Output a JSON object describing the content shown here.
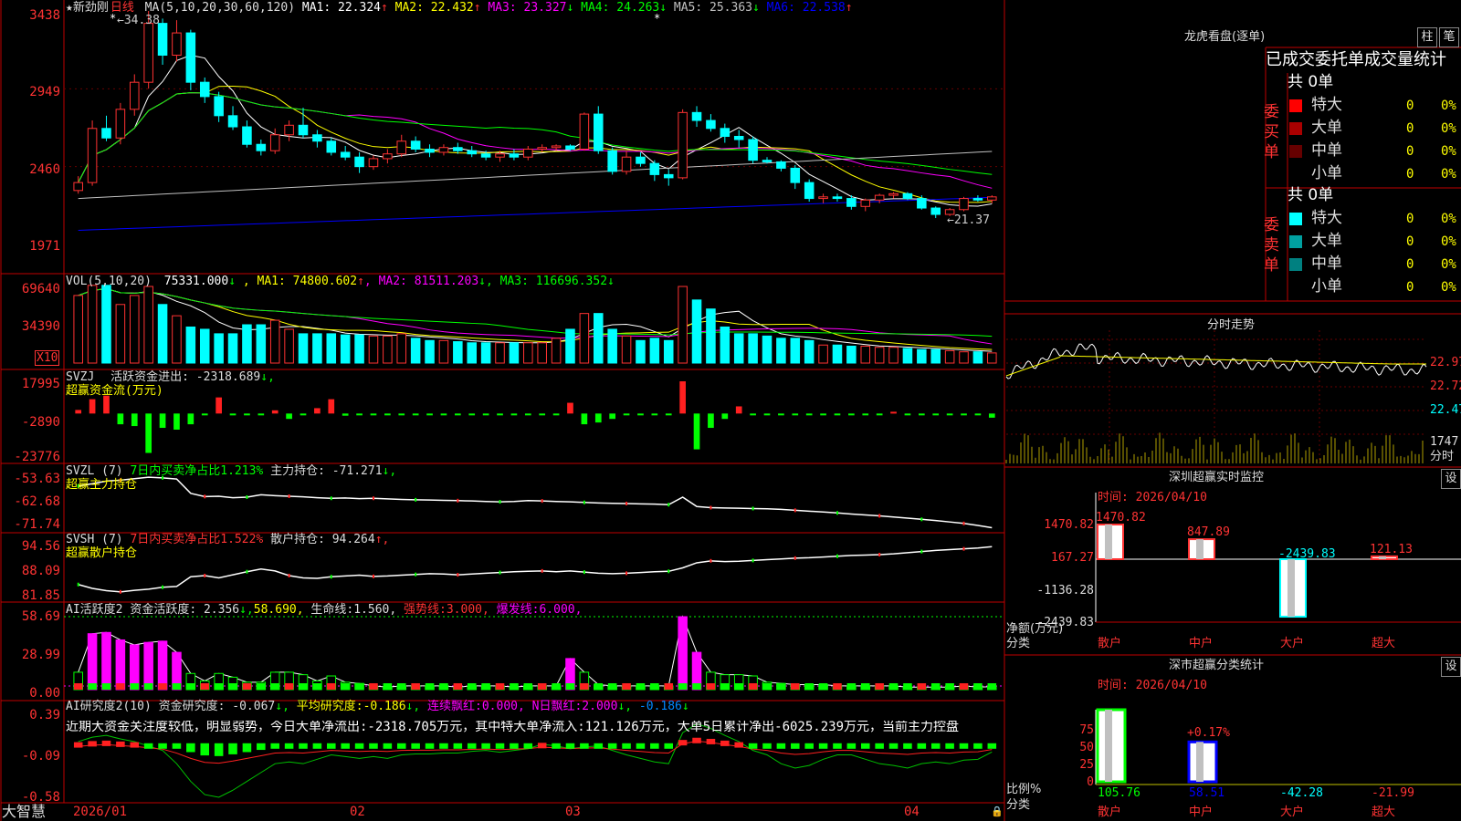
{
  "colors": {
    "up": "#ff3232",
    "down": "#00ffff",
    "grid": "#a00000",
    "ma1": "#ffffff",
    "ma2": "#ffff00",
    "ma3": "#ff00ff",
    "ma4": "#00ff00",
    "ma5": "#c0c0c0",
    "ma6": "#0000ff"
  },
  "kline": {
    "title": "★新劲刚",
    "period": "日线",
    "ma_params": "MA(5,10,20,30,60,120)",
    "ma": [
      {
        "label": "MA1:",
        "value": "22.324",
        "arrow": "↑"
      },
      {
        "label": "MA2:",
        "value": "22.432",
        "arrow": "↑"
      },
      {
        "label": "MA3:",
        "value": "23.327",
        "arrow": "↓"
      },
      {
        "label": "MA4:",
        "value": "24.263",
        "arrow": "↓"
      },
      {
        "label": "MA5:",
        "value": "25.363",
        "arrow": "↓"
      },
      {
        "label": "MA6:",
        "value": "22.538",
        "arrow": "↑"
      }
    ],
    "high_label": "34.38",
    "low_label": "21.37",
    "star": "*",
    "yaxis": [
      "3438",
      "2949",
      "2460",
      "1971"
    ]
  },
  "vol": {
    "title": "VOL(5,10,20)",
    "value": "75331.000",
    "arrow": "↓",
    "ma": [
      {
        "label": "MA1:",
        "value": "74800.602",
        "arrow": "↑"
      },
      {
        "label": "MA2:",
        "value": "81511.203",
        "arrow": "↓"
      },
      {
        "label": "MA3:",
        "value": "116696.352",
        "arrow": "↓"
      }
    ],
    "yaxis": [
      "69640",
      "34390"
    ],
    "unit": "X10"
  },
  "svzj": {
    "title": "SVZJ",
    "text": "活跃资金进出:",
    "value": "-2318.689",
    "arrow": "↓,",
    "subtitle": "超赢资金流(万元)",
    "yaxis": [
      "17995",
      "-2890",
      "-23776"
    ]
  },
  "svzl": {
    "title": "SVZL (7)",
    "t1": "7日内买卖净占比1.213%",
    "t2": "主力持仓:",
    "value": "-71.271",
    "arrow": "↓,",
    "subtitle": "超赢主力持仓",
    "yaxis": [
      "-53.63",
      "-62.68",
      "-71.74"
    ]
  },
  "svsh": {
    "title": "SVSH (7)",
    "t1": "7日内买卖净占比1.522%",
    "t2": "散户持仓:",
    "value": "94.264",
    "arrow": "↑,",
    "subtitle": "超赢散户持仓",
    "yaxis": [
      "94.56",
      "88.09",
      "81.85"
    ]
  },
  "ai1": {
    "title": "AI活跃度2",
    "t1": "资金活跃度:",
    "v1": "2.356",
    "a1": "↓,",
    "v2": "58.690,",
    "t3": "生命线:",
    "v3": "1.560,",
    "t4": "强势线:",
    "v4": "3.000,",
    "t5": "爆发线:",
    "v5": "6.000,",
    "yaxis": [
      "58.69",
      "28.99",
      "0.00"
    ]
  },
  "ai2": {
    "title": "AI研究度2(10)",
    "t1": "资金研究度:",
    "v1": "-0.067",
    "a1": "↓,",
    "t2": "平均研究度:",
    "v2": "-0.186",
    "a2": "↓,",
    "t3": "连续飘红:",
    "v3": "0.000,",
    "t4": "N日飘红:",
    "v4": "2.000",
    "a4": "↓,",
    "v5": "-0.186",
    "a5": "↓",
    "note": "近期大资金关注度较低，明显弱势，今日大单净流出:-2318.705万元，其中特大单净流入:121.126万元，大单5日累计净出-6025.239万元，当前主力控盘",
    "yaxis": [
      "0.39",
      "-0.09",
      "-0.58"
    ]
  },
  "xaxis": {
    "brand": "大智慧",
    "labels": [
      "2026/01",
      "02",
      "03",
      "04"
    ]
  },
  "right": {
    "tabs": [
      "柱",
      "笔"
    ],
    "dragon_title": "龙虎看盘(逐单)",
    "stats_header": "已成交委托单成交量统计",
    "buy_label": "委买单",
    "sell_label": "委卖单",
    "buy_total": "共 0单",
    "sell_total": "共 0单",
    "buy_rows": [
      {
        "name": "特大",
        "count": "0",
        "pct": "0%",
        "color": "#ff0000"
      },
      {
        "name": "大单",
        "count": "0",
        "pct": "0%",
        "color": "#aa0000"
      },
      {
        "name": "中单",
        "count": "0",
        "pct": "0%",
        "color": "#660000"
      },
      {
        "name": "小单",
        "count": "0",
        "pct": "0%",
        "color": ""
      }
    ],
    "sell_rows": [
      {
        "name": "特大",
        "count": "0",
        "pct": "0%",
        "color": "#00ffff"
      },
      {
        "name": "大单",
        "count": "0",
        "pct": "0%",
        "color": "#00a0a0"
      },
      {
        "name": "中单",
        "count": "0",
        "pct": "0%",
        "color": "#008080"
      },
      {
        "name": "小单",
        "count": "0",
        "pct": "0%",
        "color": ""
      }
    ],
    "intraday": {
      "title": "分时走势",
      "prices": [
        "22.97",
        "22.72",
        "22.47"
      ],
      "vol_label": "1747",
      "vol_unit": "分时"
    },
    "monitor": {
      "title": "深圳超赢实时监控",
      "time": "时间: 2026/04/10",
      "btn": "设",
      "yaxis": [
        "1470.82",
        "167.27",
        "-1136.28",
        "-2439.83"
      ],
      "ylabel1": "净额(万元)",
      "ylabel2": "分类",
      "cats": [
        "散户",
        "中户",
        "大户",
        "超大"
      ],
      "values": [
        "1470.82",
        "847.89",
        "-2439.83",
        "121.13"
      ]
    },
    "classify": {
      "title": "深市超赢分类统计",
      "time": "时间: 2026/04/10",
      "btn": "设",
      "yaxis": [
        "75",
        "50",
        "25",
        "0"
      ],
      "ylabel1": "比例%",
      "ylabel2": "分类",
      "cats": [
        "散户",
        "中户",
        "大户",
        "超大"
      ],
      "values": [
        "105.76",
        "58.51",
        "-42.28",
        "-21.99"
      ],
      "note": "+0.17%"
    }
  },
  "chart_data": [
    {
      "type": "candlestick",
      "title": "新劲刚 日线",
      "ylim": [
        19.71,
        34.38
      ],
      "x": [
        "2026/01",
        "02",
        "03",
        "04"
      ],
      "ohlc": [
        [
          23.1,
          24.0,
          22.9,
          23.6
        ],
        [
          23.6,
          27.5,
          23.4,
          27.0
        ],
        [
          27.0,
          27.8,
          26.2,
          26.4
        ],
        [
          26.4,
          28.6,
          26.0,
          28.2
        ],
        [
          28.2,
          30.4,
          27.8,
          29.9
        ],
        [
          29.9,
          34.38,
          29.5,
          33.6
        ],
        [
          33.6,
          33.9,
          31.0,
          31.6
        ],
        [
          31.6,
          33.8,
          31.2,
          33.0
        ],
        [
          33.0,
          33.2,
          29.4,
          29.9
        ],
        [
          29.9,
          30.2,
          28.6,
          29.0
        ],
        [
          29.0,
          29.3,
          27.4,
          27.8
        ],
        [
          27.8,
          28.4,
          26.9,
          27.1
        ],
        [
          27.1,
          27.5,
          25.8,
          26.0
        ],
        [
          26.0,
          26.3,
          25.3,
          25.6
        ],
        [
          25.6,
          27.0,
          25.4,
          26.6
        ],
        [
          26.6,
          27.5,
          26.2,
          27.2
        ],
        [
          27.2,
          28.3,
          26.4,
          26.6
        ],
        [
          26.6,
          26.9,
          25.8,
          26.2
        ],
        [
          26.2,
          26.4,
          25.3,
          25.5
        ],
        [
          25.5,
          25.9,
          25.0,
          25.2
        ],
        [
          25.2,
          25.5,
          24.2,
          24.6
        ],
        [
          24.6,
          25.3,
          24.4,
          25.1
        ],
        [
          25.1,
          25.7,
          24.8,
          25.4
        ],
        [
          25.4,
          26.6,
          25.2,
          26.2
        ],
        [
          26.2,
          26.5,
          25.5,
          25.7
        ],
        [
          25.7,
          26.0,
          25.2,
          25.5
        ],
        [
          25.5,
          26.0,
          25.3,
          25.8
        ],
        [
          25.8,
          26.1,
          25.4,
          25.6
        ],
        [
          25.6,
          25.9,
          25.2,
          25.4
        ],
        [
          25.4,
          25.6,
          25.0,
          25.2
        ],
        [
          25.2,
          25.6,
          24.9,
          25.4
        ],
        [
          25.4,
          25.7,
          25.0,
          25.2
        ],
        [
          25.2,
          25.9,
          25.0,
          25.7
        ],
        [
          25.7,
          26.0,
          25.5,
          25.8
        ],
        [
          25.8,
          26.0,
          25.6,
          25.9
        ],
        [
          25.9,
          26.0,
          25.6,
          25.7
        ],
        [
          25.7,
          28.0,
          25.6,
          27.9
        ],
        [
          27.9,
          28.4,
          25.4,
          25.6
        ],
        [
          25.6,
          25.8,
          24.1,
          24.3
        ],
        [
          24.3,
          25.6,
          24.1,
          25.2
        ],
        [
          25.2,
          25.5,
          24.6,
          24.8
        ],
        [
          24.8,
          25.0,
          23.7,
          24.1
        ],
        [
          24.1,
          24.4,
          23.4,
          23.9
        ],
        [
          23.9,
          28.2,
          23.8,
          28.0
        ],
        [
          28.0,
          28.4,
          27.1,
          27.5
        ],
        [
          27.5,
          27.9,
          26.8,
          27.0
        ],
        [
          27.0,
          27.3,
          26.1,
          26.5
        ],
        [
          26.5,
          26.9,
          25.8,
          26.3
        ],
        [
          26.3,
          26.5,
          24.8,
          25.0
        ],
        [
          25.0,
          25.2,
          24.8,
          24.9
        ],
        [
          24.9,
          25.0,
          24.3,
          24.5
        ],
        [
          24.5,
          24.7,
          23.2,
          23.6
        ],
        [
          23.6,
          23.8,
          22.4,
          22.6
        ],
        [
          22.6,
          22.9,
          22.3,
          22.7
        ],
        [
          22.7,
          22.9,
          22.4,
          22.6
        ],
        [
          22.6,
          22.8,
          21.9,
          22.1
        ],
        [
          22.1,
          22.6,
          21.8,
          22.5
        ],
        [
          22.5,
          22.9,
          22.3,
          22.8
        ],
        [
          22.8,
          23.0,
          22.6,
          22.9
        ],
        [
          22.9,
          23.0,
          22.5,
          22.6
        ],
        [
          22.6,
          22.8,
          21.9,
          22.0
        ],
        [
          22.0,
          22.1,
          21.37,
          21.6
        ],
        [
          21.6,
          22.0,
          21.5,
          21.9
        ],
        [
          21.9,
          22.7,
          21.8,
          22.6
        ],
        [
          22.6,
          22.8,
          22.4,
          22.5
        ],
        [
          22.5,
          22.8,
          22.3,
          22.7
        ]
      ]
    },
    {
      "type": "bar",
      "title": "VOL(5,10,20)",
      "ylim": [
        0,
        69640
      ],
      "values": [
        60000,
        69000,
        69000,
        52000,
        60000,
        68000,
        52000,
        42000,
        32000,
        30000,
        26000,
        26000,
        34000,
        34000,
        38000,
        30000,
        26000,
        26000,
        26000,
        25000,
        25000,
        24000,
        24000,
        26000,
        22000,
        20000,
        20000,
        19000,
        18000,
        18000,
        18000,
        18000,
        18000,
        18000,
        22000,
        30000,
        44000,
        44000,
        30000,
        24000,
        20000,
        22000,
        20000,
        68000,
        56000,
        48000,
        32000,
        26000,
        26000,
        24000,
        22000,
        22000,
        20000,
        16000,
        16000,
        15000,
        15000,
        14000,
        14000,
        13000,
        12000,
        12000,
        11000,
        10000,
        10000,
        9000
      ]
    },
    {
      "type": "bar",
      "title": "超赢资金流(万元)",
      "ylim": [
        -23776,
        17995
      ],
      "values": [
        2000,
        8000,
        10000,
        -6000,
        -7000,
        -22000,
        -8000,
        -9000,
        -6000,
        -1000,
        9000,
        -800,
        -800,
        -900,
        1800,
        -3000,
        -600,
        3000,
        8000,
        -1200,
        -900,
        -900,
        -900,
        -600,
        -600,
        -900,
        -700,
        -500,
        -600,
        -600,
        -900,
        -800,
        -600,
        -600,
        -600,
        6000,
        -6000,
        -5000,
        -3000,
        -700,
        -600,
        -600,
        -600,
        17995,
        -20000,
        -8000,
        -3000,
        4000,
        -900,
        -900,
        -800,
        -700,
        -600,
        -700,
        -600,
        -500,
        -500,
        -600,
        1000,
        -500,
        -700,
        -400,
        -600,
        -600,
        -700,
        -2318
      ]
    },
    {
      "type": "line",
      "title": "超赢主力持仓",
      "ylim": [
        -71.74,
        -53.63
      ],
      "values": [
        -57.0,
        -56.2,
        -55.3,
        -55.0,
        -54.5,
        -54.0,
        -54.2,
        -54.6,
        -59.5,
        -60.6,
        -60.5,
        -61.0,
        -60.8,
        -60.0,
        -60.3,
        -60.5,
        -60.7,
        -61.0,
        -61.2,
        -61.1,
        -61.3,
        -61.2,
        -61.4,
        -61.6,
        -61.7,
        -61.8,
        -61.9,
        -62.0,
        -62.1,
        -62.3,
        -62.4,
        -62.3,
        -62.0,
        -62.1,
        -62.3,
        -62.4,
        -62.6,
        -62.8,
        -62.9,
        -63.0,
        -63.1,
        -63.2,
        -63.4,
        -60.8,
        -64.0,
        -64.4,
        -64.5,
        -64.6,
        -64.7,
        -64.8,
        -65.0,
        -65.3,
        -65.6,
        -65.9,
        -66.2,
        -66.6,
        -66.9,
        -67.2,
        -67.6,
        -68.0,
        -68.4,
        -68.8,
        -69.3,
        -69.8,
        -70.5,
        -71.27
      ]
    },
    {
      "type": "line",
      "title": "超赢散户持仓",
      "ylim": [
        81.85,
        94.56
      ],
      "values": [
        84.5,
        83.5,
        82.9,
        82.6,
        83.0,
        83.3,
        83.8,
        84.0,
        86.5,
        86.8,
        86.2,
        87.0,
        87.8,
        88.5,
        88.0,
        86.8,
        86.2,
        86.1,
        86.5,
        86.7,
        86.9,
        86.6,
        86.7,
        86.9,
        87.1,
        87.3,
        87.2,
        87.0,
        87.2,
        87.4,
        87.6,
        87.8,
        87.9,
        88.0,
        87.8,
        88.0,
        87.7,
        87.4,
        87.3,
        87.4,
        87.6,
        87.8,
        87.9,
        88.8,
        90.1,
        90.6,
        90.4,
        90.5,
        90.7,
        90.9,
        91.1,
        91.3,
        91.4,
        91.6,
        91.8,
        92.0,
        92.1,
        92.2,
        92.4,
        92.7,
        93.0,
        93.3,
        93.5,
        93.7,
        93.9,
        94.26
      ]
    },
    {
      "type": "bar",
      "title": "AI活跃度2",
      "ylim": [
        0,
        58.69
      ],
      "values": [
        14,
        45,
        46,
        40,
        36,
        38,
        39,
        30,
        13,
        7,
        13,
        10,
        6,
        6,
        14,
        14,
        12,
        7,
        11,
        6,
        5,
        3,
        2,
        3,
        3,
        3,
        3,
        2,
        3,
        3,
        3,
        2,
        3,
        3,
        3,
        25,
        14,
        4,
        3,
        3,
        3,
        3,
        3,
        58.69,
        30,
        14,
        12,
        12,
        11,
        6,
        5,
        4,
        4,
        4,
        3,
        3,
        3,
        3,
        3,
        2,
        2,
        2,
        2,
        3,
        2,
        2.356
      ]
    },
    {
      "type": "line",
      "title": "AI研究度2(10)",
      "ylim": [
        -0.58,
        0.39
      ],
      "values": [
        0.05,
        0.1,
        0.12,
        0.08,
        0.05,
        0.0,
        -0.05,
        -0.2,
        -0.4,
        -0.55,
        -0.58,
        -0.5,
        -0.4,
        -0.3,
        -0.2,
        -0.18,
        -0.2,
        -0.15,
        -0.1,
        -0.12,
        -0.14,
        -0.12,
        -0.14,
        -0.1,
        -0.09,
        -0.09,
        -0.08,
        -0.08,
        -0.06,
        -0.05,
        -0.07,
        -0.05,
        -0.03,
        0.02,
        0.0,
        -0.03,
        -0.01,
        0.0,
        -0.05,
        -0.1,
        -0.14,
        -0.18,
        -0.2,
        0.15,
        0.25,
        0.2,
        0.12,
        0.05,
        -0.05,
        -0.1,
        -0.2,
        -0.25,
        -0.22,
        -0.15,
        -0.1,
        -0.1,
        -0.15,
        -0.2,
        -0.22,
        -0.25,
        -0.2,
        -0.18,
        -0.2,
        -0.16,
        -0.15,
        -0.067
      ]
    },
    {
      "type": "bar",
      "title": "深圳超赢实时监控",
      "categories": [
        "散户",
        "中户",
        "大户",
        "超大"
      ],
      "values": [
        1470.82,
        847.89,
        -2439.83,
        121.13
      ]
    },
    {
      "type": "bar",
      "title": "深市超赢分类统计",
      "categories": [
        "散户",
        "中户",
        "大户",
        "超大"
      ],
      "values": [
        105.76,
        58.51,
        -42.28,
        -21.99
      ]
    }
  ]
}
